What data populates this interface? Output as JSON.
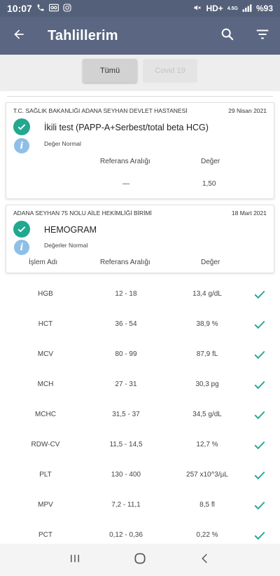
{
  "statusbar": {
    "time": "10:07",
    "left_icons": [
      "phone-icon",
      "voicemail-icon",
      "instagram-icon"
    ],
    "network": "HD+",
    "network_type": "4.5G",
    "battery": "%93"
  },
  "appbar": {
    "title": "Tahlillerim",
    "back_icon": "arrow-left-icon",
    "search_icon": "search-icon",
    "filter_icon": "filter-icon"
  },
  "tabs": [
    {
      "label": "Tümü",
      "active": true
    },
    {
      "label": "Covid 19",
      "active": false
    }
  ],
  "cards": [
    {
      "institution": "T.C. SAĞLIK BAKANLIĞI ADANA SEYHAN DEVLET HASTANESİ",
      "date": "29 Nisan 2021",
      "test_name": "İkili test (PAPP-A+Serbest/total beta HCG)",
      "status": "Değer Normal",
      "headers": {
        "reference": "Referans Aralığı",
        "value": "Değer"
      },
      "row": {
        "reference": "—",
        "value": "1,50"
      }
    },
    {
      "institution": "ADANA SEYHAN 75 NOLU AİLE HEKİMLİĞİ BİRİMİ",
      "date": "18 Mart 2021",
      "test_name": "HEMOGRAM",
      "status": "Değerler Normal",
      "headers": {
        "name": "İşlem Adı",
        "reference": "Referans Aralığı",
        "value": "Değer"
      }
    }
  ],
  "hemogram_rows": [
    {
      "name": "HGB",
      "reference": "12 - 18",
      "value": "13,4 g/dL"
    },
    {
      "name": "HCT",
      "reference": "36 - 54",
      "value": "38,9 %"
    },
    {
      "name": "MCV",
      "reference": "80 - 99",
      "value": "87,9 fL"
    },
    {
      "name": "MCH",
      "reference": "27 - 31",
      "value": "30,3 pg"
    },
    {
      "name": "MCHC",
      "reference": "31,5 - 37",
      "value": "34,5 g/dL"
    },
    {
      "name": "RDW-CV",
      "reference": "11,5 - 14,5",
      "value": "12,7 %"
    },
    {
      "name": "PLT",
      "reference": "130 - 400",
      "value": "257 x10^3/µL"
    },
    {
      "name": "MPV",
      "reference": "7,2 - 11,1",
      "value": "8,5 fl"
    },
    {
      "name": "PCT",
      "reference": "0,12 - 0,36",
      "value": "0,22 %"
    }
  ],
  "colors": {
    "appbar": "#5a6682",
    "statusbar": "#546079",
    "check": "#22a88f",
    "info": "#8fbfe6"
  },
  "navbar": [
    "recent-apps-icon",
    "home-icon",
    "back-icon"
  ]
}
